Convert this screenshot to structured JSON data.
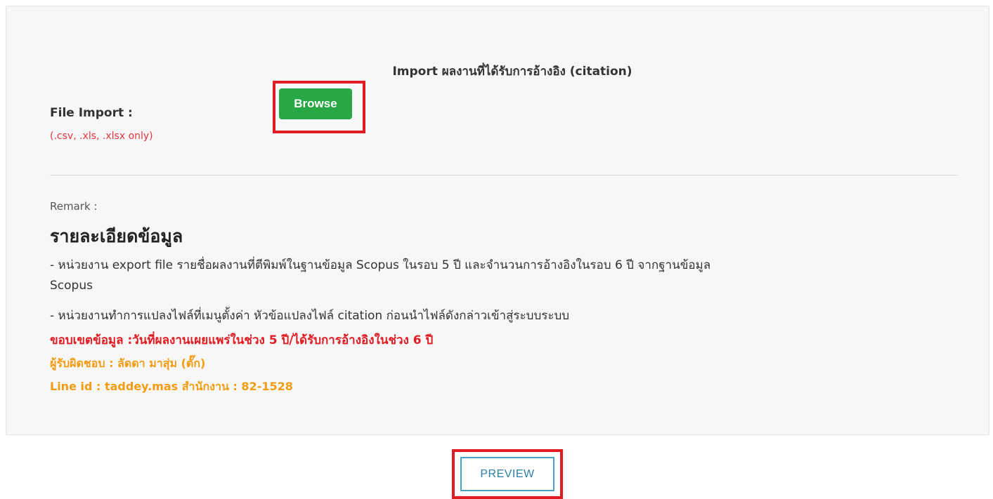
{
  "panel": {
    "title": "Import ผลงานที่ได้รับการอ้างอิง (citation)"
  },
  "file_import": {
    "label": "File Import :",
    "hint": "(.csv, .xls, .xlsx only)",
    "browse_label": "Browse"
  },
  "remark": {
    "label": "Remark :",
    "heading": "รายละเอียดข้อมูล",
    "lines": [
      "- หน่วยงาน export file รายชื่อผลงานที่ตีพิมพ์ในฐานข้อมูล Scopus ในรอบ 5 ปี และจำนวนการอ้างอิงในรอบ 6 ปี จากฐานข้อมูล",
      "Scopus",
      "- หน่วยงานทำการแปลงไฟล์ที่เมนูตั้งค่า หัวข้อแปลงไฟล์ citation ก่อนนำไฟล์ดังกล่าวเข้าสู่ระบบระบบ"
    ],
    "scope": "ขอบเขตข้อมูล :วันที่ผลงานเผยแพร่ในช่วง 5 ปี/ได้รับการอ้างอิงในช่วง 6 ปี",
    "contact_person": "ผู้รับผิดชอบ : ลัดดา มาสุ่ม (ตั๊ก)",
    "contact_line": "Line id : taddey.mas สำนักงาน : 82-1528"
  },
  "actions": {
    "preview_label": "PREVIEW"
  },
  "colors": {
    "browse_bg": "#28a745",
    "highlight": "#e11b22",
    "hint": "#e8353b",
    "contact": "#f39c12",
    "preview_border": "#4aa3c7"
  }
}
